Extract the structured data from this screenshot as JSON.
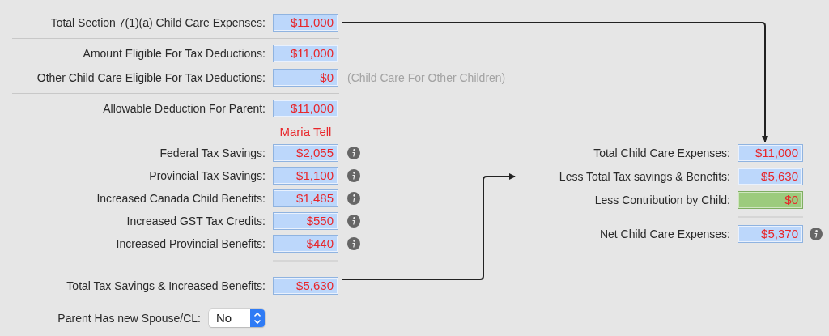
{
  "total_expenses": {
    "label": "Total Section 7(1)(a) Child Care Expenses:",
    "value": "$11,000"
  },
  "eligible": [
    {
      "label": "Amount Eligible For Tax Deductions:",
      "value": "$11,000"
    },
    {
      "label": "Other Child Care Eligible For Tax Deductions:",
      "value": "$0",
      "note": "(Child Care For Other Children)"
    }
  ],
  "allowable": {
    "label": "Allowable Deduction For Parent:",
    "value": "$11,000"
  },
  "parent_name": "Maria Tell",
  "savings": [
    {
      "label": "Federal Tax Savings:",
      "value": "$2,055"
    },
    {
      "label": "Provincial Tax Savings:",
      "value": "$1,100"
    },
    {
      "label": "Increased Canada Child Benefits:",
      "value": "$1,485"
    },
    {
      "label": "Increased GST Tax Credits:",
      "value": "$550"
    },
    {
      "label": "Increased Provincial Benefits:",
      "value": "$440"
    }
  ],
  "total_savings": {
    "label": "Total Tax Savings & Increased Benefits:",
    "value": "$5,630"
  },
  "summary": [
    {
      "label": "Total Child Care Expenses:",
      "value": "$11,000",
      "kind": "computed"
    },
    {
      "label": "Less Total Tax savings & Benefits:",
      "value": "$5,630",
      "kind": "computed"
    },
    {
      "label": "Less Contribution by Child:",
      "value": "$0",
      "kind": "input"
    }
  ],
  "net": {
    "label": "Net Child Care Expenses:",
    "value": "$5,370"
  },
  "spouse": {
    "label": "Parent Has new Spouse/CL:",
    "value": "No"
  }
}
